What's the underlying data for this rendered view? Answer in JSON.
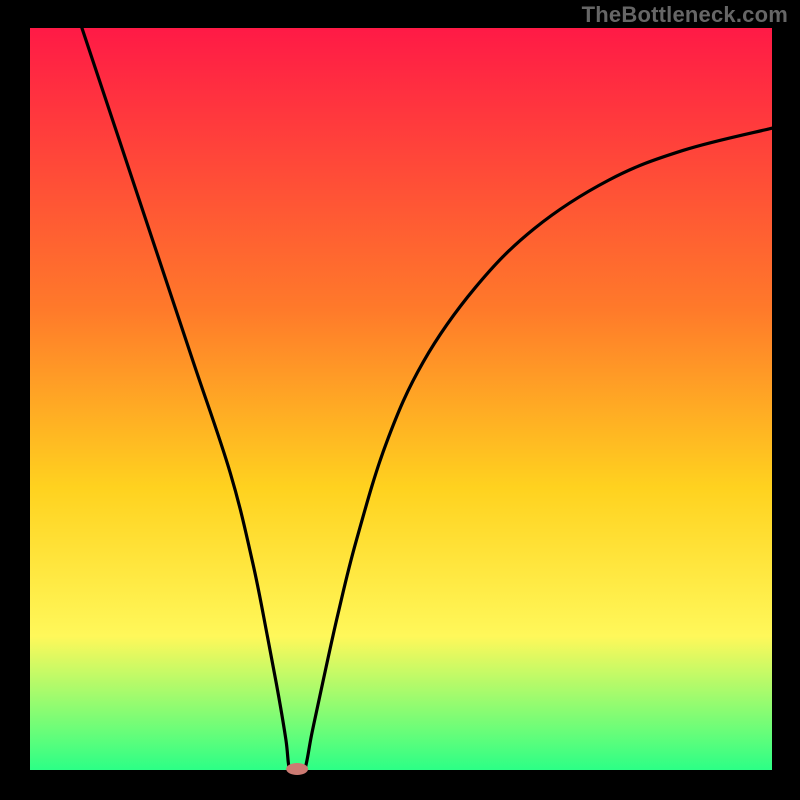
{
  "watermark": "TheBottleneck.com",
  "chart_data": {
    "type": "line",
    "title": "",
    "xlabel": "",
    "ylabel": "",
    "xlim": [
      0,
      100
    ],
    "ylim": [
      0,
      100
    ],
    "background_gradient": {
      "top": "#ff1a46",
      "mid1": "#ff7a2a",
      "mid2": "#ffd21f",
      "mid3": "#fff85a",
      "bottom": "#2cff86"
    },
    "series": [
      {
        "name": "left-branch",
        "comment": "Descending limb from top-left down into the notch",
        "x": [
          7,
          12,
          17,
          22,
          27,
          30,
          32,
          33.5,
          34.5,
          35
        ],
        "y": [
          100,
          85,
          70,
          55,
          40,
          28,
          18,
          10,
          4,
          0
        ]
      },
      {
        "name": "right-branch",
        "comment": "Ascending limb rising from the notch toward upper-right, concave, flattening",
        "x": [
          37,
          38,
          39.5,
          41.5,
          44,
          48,
          53,
          60,
          68,
          78,
          88,
          100
        ],
        "y": [
          0,
          5,
          12,
          21,
          31,
          44,
          55,
          65,
          73,
          79.5,
          83.5,
          86.5
        ]
      }
    ],
    "marker": {
      "comment": "small salmon marker at the notch minimum",
      "x": 36,
      "y": 0,
      "color": "#cc7a72"
    }
  }
}
